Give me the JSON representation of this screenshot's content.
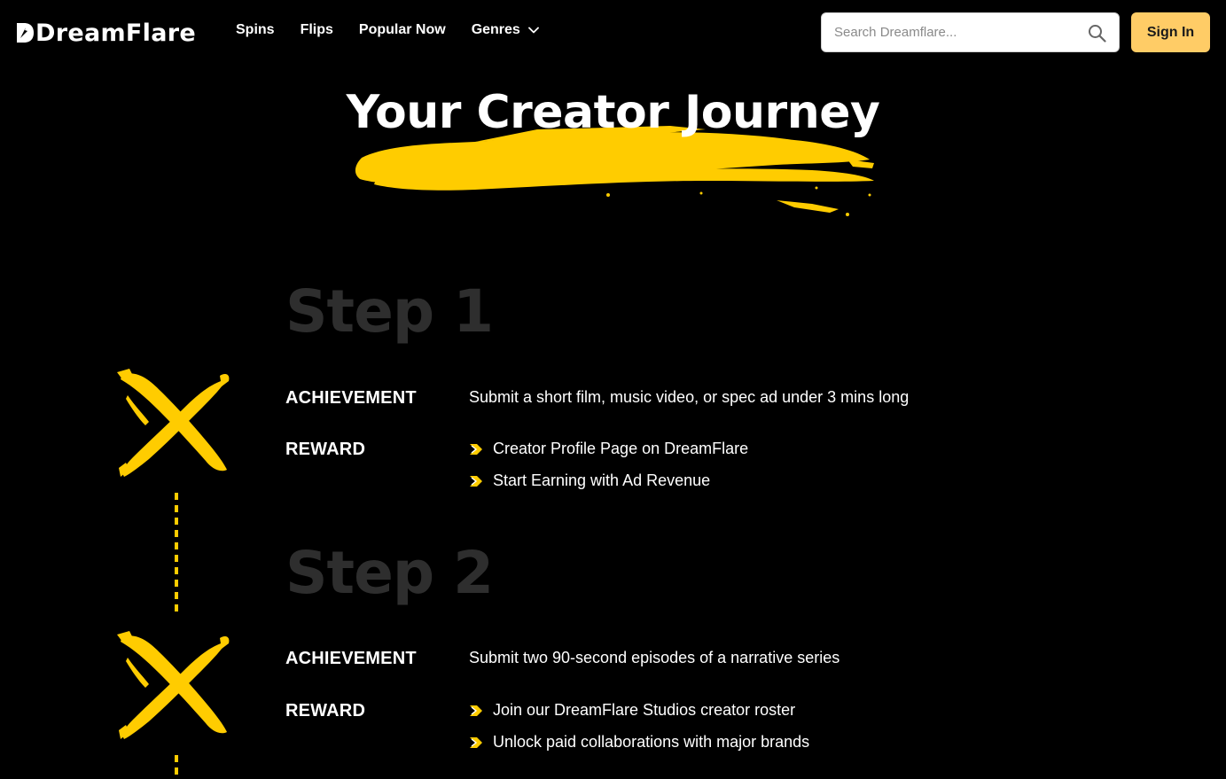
{
  "brand": {
    "name": "DreamFlare"
  },
  "nav": {
    "links": [
      {
        "label": "Spins"
      },
      {
        "label": "Flips"
      },
      {
        "label": "Popular Now"
      },
      {
        "label": "Genres"
      }
    ],
    "search_placeholder": "Search Dreamflare...",
    "signin_label": "Sign In"
  },
  "hero": {
    "title": "Your Creator Journey"
  },
  "steps": [
    {
      "heading": "Step 1",
      "achievement_label": "ACHIEVEMENT",
      "achievement_text": "Submit a short film, music video, or spec ad under 3 mins long",
      "reward_label": "REWARD",
      "rewards": [
        "Creator Profile Page on DreamFlare",
        "Start Earning with Ad Revenue"
      ]
    },
    {
      "heading": "Step 2",
      "achievement_label": "ACHIEVEMENT",
      "achievement_text": "Submit two 90-second episodes of a narrative series",
      "reward_label": "REWARD",
      "rewards": [
        "Join our DreamFlare Studios creator roster",
        "Unlock paid collaborations with major brands"
      ]
    }
  ],
  "colors": {
    "accent": "#ffcc00",
    "signin_bg": "#ffcc66",
    "step_heading": "#2e2e2e"
  },
  "icons": [
    "dreamflare-logo-icon",
    "chevron-down-icon",
    "search-icon",
    "x-mark-icon",
    "reward-bullet-icon"
  ]
}
